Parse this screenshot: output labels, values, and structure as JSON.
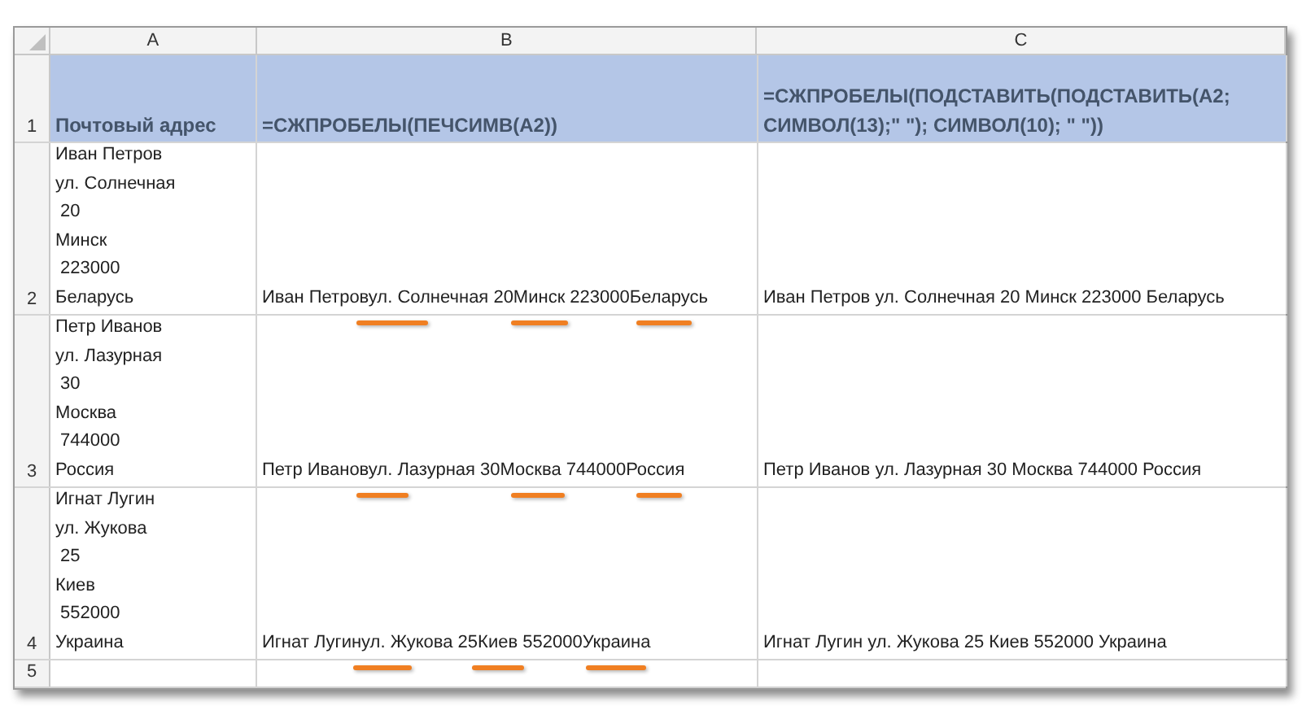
{
  "column_headers": [
    "A",
    "B",
    "C"
  ],
  "rows": [
    {
      "number": "1",
      "kind": "header",
      "cells": [
        [
          "Почтовый адрес"
        ],
        [
          "=СЖПРОБЕЛЫ(ПЕЧСИМВ(A2))"
        ],
        [
          "=СЖПРОБЕЛЫ(ПОДСТАВИТЬ(ПОДСТАВИТЬ(A2;",
          "СИМВОЛ(13);\" \"); СИМВОЛ(10); \" \"))"
        ]
      ]
    },
    {
      "number": "2",
      "kind": "data",
      "cells": [
        [
          "Иван Петров",
          "ул. Солнечная",
          " 20",
          "Минск",
          " 223000",
          "Беларусь"
        ],
        [
          "Иван Петровул. Солнечная 20Минск 223000Беларусь"
        ],
        [
          "Иван Петров ул. Солнечная 20 Минск 223000 Беларусь"
        ]
      ]
    },
    {
      "number": "3",
      "kind": "data",
      "cells": [
        [
          "Петр Иванов",
          "ул. Лазурная",
          " 30",
          "Москва",
          " 744000",
          "Россия"
        ],
        [
          "Петр Ивановул. Лазурная 30Москва 744000Россия"
        ],
        [
          "Петр Иванов ул. Лазурная 30 Москва 744000 Россия"
        ]
      ]
    },
    {
      "number": "4",
      "kind": "data",
      "cells": [
        [
          "Игнат Лугин",
          "ул. Жукова",
          " 25",
          "Киев",
          " 552000",
          "Украина"
        ],
        [
          "Игнат Лугинул. Жукова 25Киев 552000Украина"
        ],
        [
          "Игнат Лугин ул. Жукова 25 Киев 552000 Украина"
        ]
      ]
    },
    {
      "number": "5",
      "kind": "empty",
      "cells": [
        [],
        [],
        []
      ]
    }
  ]
}
